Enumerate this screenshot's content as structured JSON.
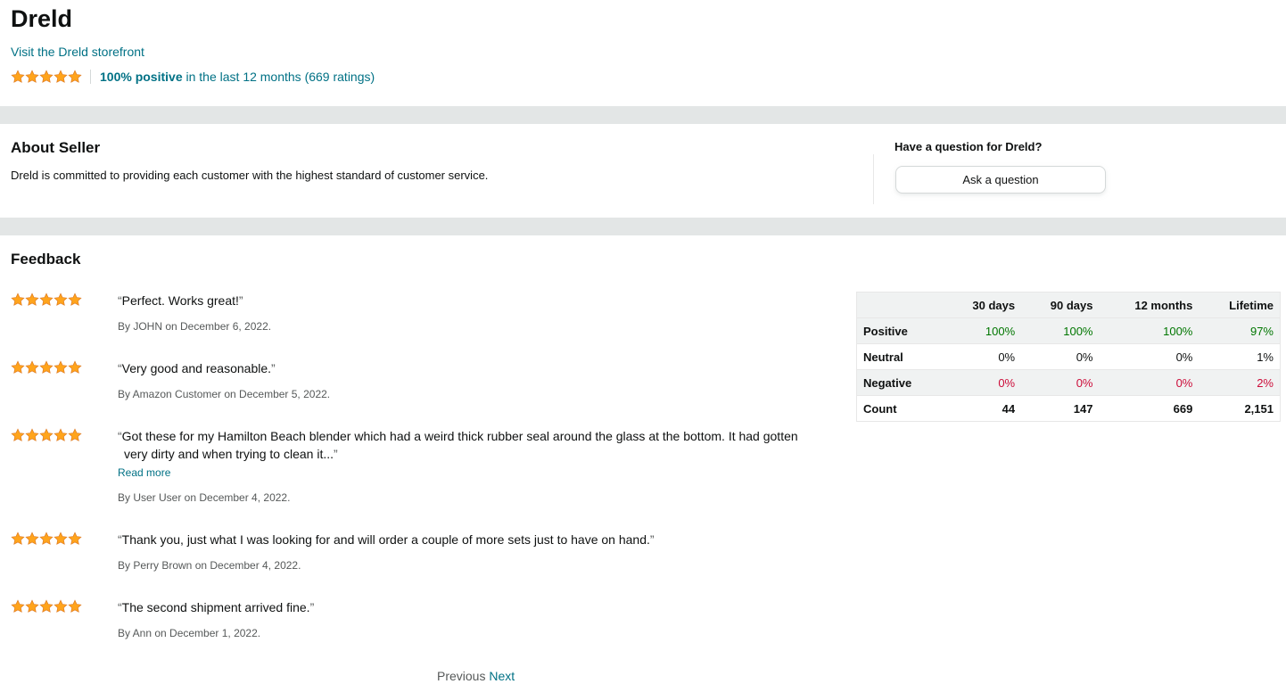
{
  "seller": {
    "name": "Dreld",
    "storefront_link": "Visit the Dreld storefront",
    "rating_percent": "100% positive",
    "rating_suffix": " in the last 12 months (669 ratings)",
    "stars": 5
  },
  "about": {
    "title": "About Seller",
    "text": "Dreld is committed to providing each customer with the highest standard of customer service."
  },
  "question": {
    "title": "Have a question for Dreld?",
    "button_label": "Ask a question"
  },
  "feedback": {
    "title": "Feedback",
    "reviews": [
      {
        "stars": 5,
        "quote": "Perfect. Works great!",
        "byline": "By JOHN on December 6, 2022."
      },
      {
        "stars": 5,
        "quote": "Very good and reasonable.",
        "byline": "By Amazon Customer on December 5, 2022."
      },
      {
        "stars": 5,
        "quote_line1": "Got these for my Hamilton Beach blender which had a weird thick rubber seal around the glass at the bottom. It had gotten",
        "quote_line2": "very dirty and when trying to clean it...",
        "read_more": "Read more",
        "byline": "By User User on December 4, 2022."
      },
      {
        "stars": 5,
        "quote": "Thank you, just what I was looking for and will order a couple of more sets just to have on hand.",
        "byline": "By Perry Brown on December 4, 2022."
      },
      {
        "stars": 5,
        "quote": "The second shipment arrived fine.",
        "byline": "By Ann on December 1, 2022."
      }
    ],
    "quote_open": "“",
    "quote_close": "”"
  },
  "stats": {
    "headers": [
      "",
      "30 days",
      "90 days",
      "12 months",
      "Lifetime"
    ],
    "rows": [
      {
        "label": "Positive",
        "values": [
          "100%",
          "100%",
          "100%",
          "97%"
        ]
      },
      {
        "label": "Neutral",
        "values": [
          "0%",
          "0%",
          "0%",
          "1%"
        ]
      },
      {
        "label": "Negative",
        "values": [
          "0%",
          "0%",
          "0%",
          "2%"
        ]
      },
      {
        "label": "Count",
        "values": [
          "44",
          "147",
          "669",
          "2,151"
        ]
      }
    ]
  },
  "pager": {
    "previous": "Previous",
    "next": "Next"
  },
  "colors": {
    "star": "#ffa41c",
    "link": "#007185",
    "positive": "#007600",
    "negative": "#cc0c39",
    "band": "#e3e6e6"
  }
}
